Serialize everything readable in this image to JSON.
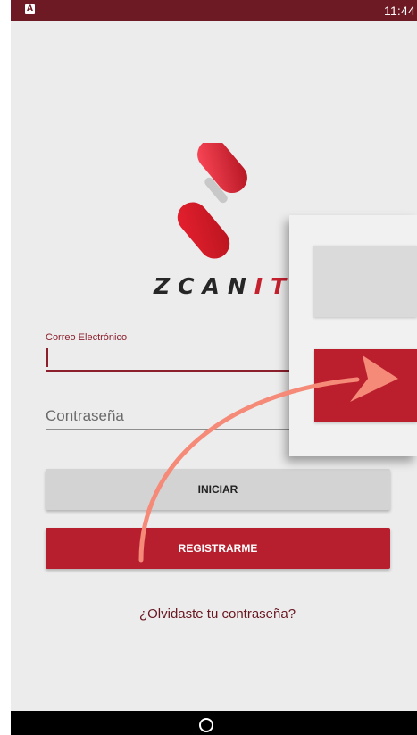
{
  "status_bar": {
    "time": "11:44",
    "app_icon": "A"
  },
  "logo": {
    "brand_prefix": "ZCAN",
    "brand_accent": "IT",
    "icon": "zcanit-logo-icon"
  },
  "form": {
    "email_label": "Correo Electrónico",
    "email_value": "",
    "password_placeholder": "Contraseña"
  },
  "buttons": {
    "login": "INICIAR",
    "register": "REGISTRARME"
  },
  "forgot_password": "¿Olvidaste tu contraseña?",
  "nav": {
    "home_icon": "home-circle-icon"
  },
  "colors": {
    "brand_red": "#b71f2e",
    "dark_red": "#6e1a24",
    "arrow": "#f58a78"
  }
}
